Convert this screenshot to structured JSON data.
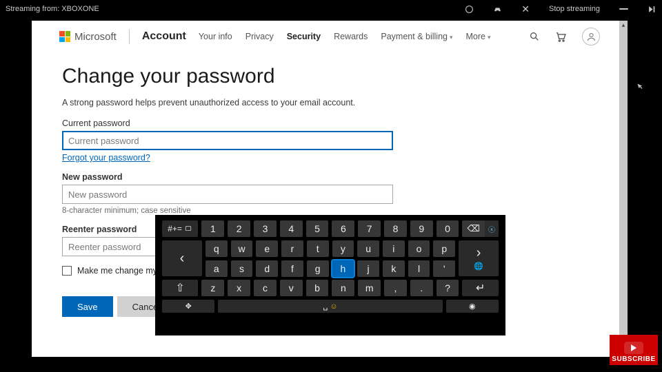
{
  "stream_bar": {
    "left": "Streaming from: XBOXONE",
    "stop": "Stop streaming"
  },
  "header": {
    "brand": "Microsoft",
    "section": "Account",
    "nav": {
      "your_info": "Your info",
      "privacy": "Privacy",
      "security": "Security",
      "rewards": "Rewards",
      "payment": "Payment & billing",
      "more": "More"
    }
  },
  "page": {
    "title": "Change your password",
    "subtitle": "A strong password helps prevent unauthorized access to your email account.",
    "current_label": "Current password",
    "current_placeholder": "Current password",
    "forgot": "Forgot your password?",
    "new_label": "New password",
    "new_placeholder": "New password",
    "hint": "8-character minimum; case sensitive",
    "reenter_label": "Reenter password",
    "reenter_placeholder": "Reenter password",
    "change72": "Make me change my p",
    "save": "Save",
    "cancel": "Cancel"
  },
  "keyboard": {
    "sym": "#+=",
    "row_num": [
      "1",
      "2",
      "3",
      "4",
      "5",
      "6",
      "7",
      "8",
      "9",
      "0"
    ],
    "row_q": [
      "q",
      "w",
      "e",
      "r",
      "t",
      "y",
      "u",
      "i",
      "o",
      "p"
    ],
    "row_a": [
      "a",
      "s",
      "d",
      "f",
      "g",
      "h",
      "j",
      "k",
      "l",
      "'"
    ],
    "row_z": [
      "z",
      "x",
      "c",
      "v",
      "b",
      "n",
      "m",
      ",",
      ".",
      "?"
    ],
    "highlight": "h",
    "left_nav": "‹",
    "right_nav": "›",
    "shift": "⇧",
    "enter": "↵",
    "space": "␣",
    "globe": "🌐",
    "bs": "⌫",
    "bs_x": "ⓧ",
    "move": "✥",
    "emoji": "☺",
    "mic": "◉"
  },
  "subscribe": "SUBSCRIBE"
}
